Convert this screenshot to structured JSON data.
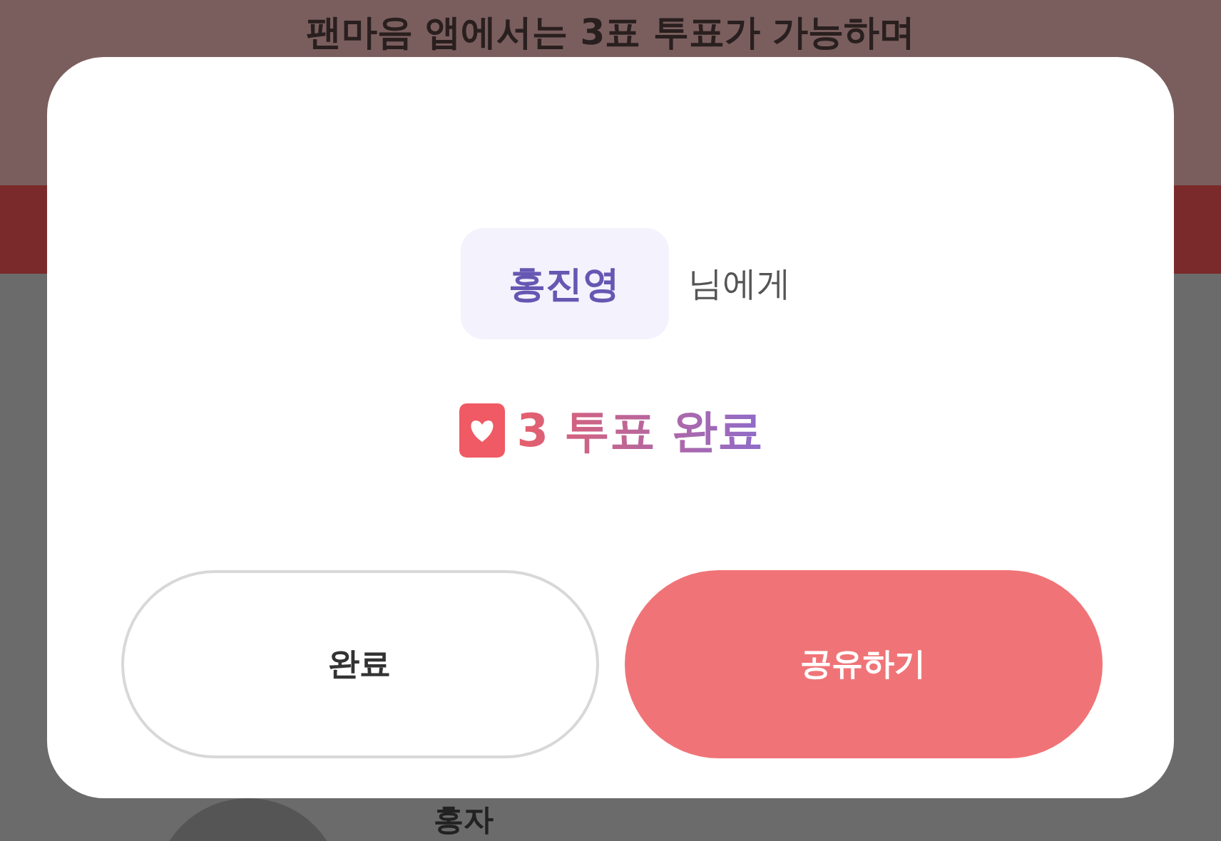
{
  "background": {
    "notice": "팬마음 앱에서는 3표 투표가 가능하며",
    "list_item": {
      "name": "홍자"
    }
  },
  "dialog": {
    "recipient": "홍진영",
    "recipient_suffix": "님에게",
    "result": "3 투표 완료",
    "buttons": [
      {
        "label": "완료",
        "kind": "secondary"
      },
      {
        "label": "공유하기",
        "kind": "primary"
      }
    ]
  }
}
